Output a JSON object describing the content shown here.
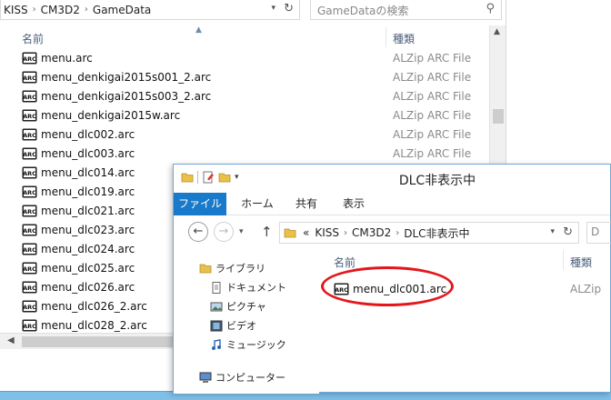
{
  "back_window": {
    "breadcrumb": [
      "KISS",
      "CM3D2",
      "GameData"
    ],
    "search_placeholder": "GameDataの検索",
    "column_name": "名前",
    "column_type": "種類",
    "files": [
      {
        "name": "menu.arc",
        "type": "ALZip ARC File"
      },
      {
        "name": "menu_denkigai2015s001_2.arc",
        "type": "ALZip ARC File"
      },
      {
        "name": "menu_denkigai2015s003_2.arc",
        "type": "ALZip ARC File"
      },
      {
        "name": "menu_denkigai2015w.arc",
        "type": "ALZip ARC File"
      },
      {
        "name": "menu_dlc002.arc",
        "type": "ALZip ARC File"
      },
      {
        "name": "menu_dlc003.arc",
        "type": "ALZip ARC File"
      },
      {
        "name": "menu_dlc014.arc",
        "type": ""
      },
      {
        "name": "menu_dlc019.arc",
        "type": ""
      },
      {
        "name": "menu_dlc021.arc",
        "type": ""
      },
      {
        "name": "menu_dlc023.arc",
        "type": ""
      },
      {
        "name": "menu_dlc024.arc",
        "type": ""
      },
      {
        "name": "menu_dlc025.arc",
        "type": ""
      },
      {
        "name": "menu_dlc026.arc",
        "type": ""
      },
      {
        "name": "menu_dlc026_2.arc",
        "type": ""
      },
      {
        "name": "menu_dlc028_2.arc",
        "type": ""
      }
    ]
  },
  "front_window": {
    "title": "DLC非表示中",
    "ribbon_tabs": [
      "ファイル",
      "ホーム",
      "共有",
      "表示"
    ],
    "breadcrumb_prefix": "«",
    "breadcrumb": [
      "KISS",
      "CM3D2",
      "DLC非表示中"
    ],
    "search_stub": "D",
    "nav_pane": [
      {
        "label": "ライブラリ",
        "icon": "library-icon"
      },
      {
        "label": "ドキュメント",
        "icon": "documents-icon"
      },
      {
        "label": "ピクチャ",
        "icon": "pictures-icon"
      },
      {
        "label": "ビデオ",
        "icon": "videos-icon"
      },
      {
        "label": "ミュージック",
        "icon": "music-icon"
      },
      {
        "label": "コンピューター",
        "icon": "computer-icon"
      }
    ],
    "column_name": "名前",
    "column_type": "種類",
    "file": {
      "name": "menu_dlc001.arc",
      "type": "ALZip"
    }
  },
  "colors": {
    "ribbon_file_tab": "#1979ca",
    "highlight_ellipse": "#e3171b",
    "taskbar": "#7fbfe8"
  }
}
